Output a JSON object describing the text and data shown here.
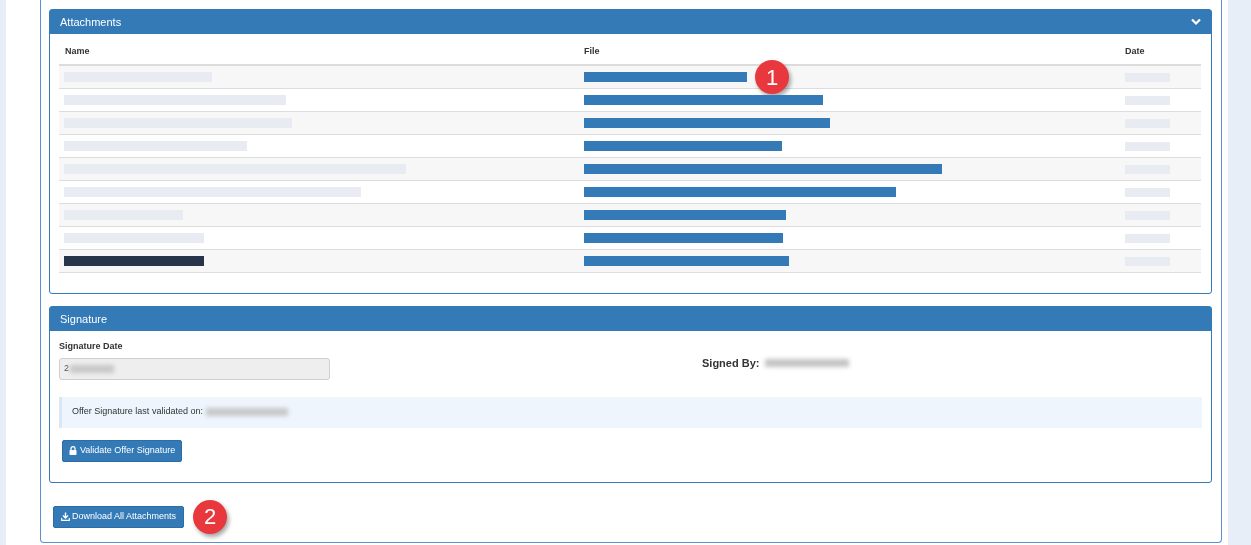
{
  "attachments": {
    "title": "Attachments",
    "expanded": true,
    "columns": [
      "Name",
      "File",
      "Date"
    ],
    "rows": [
      {
        "kind": "plain"
      },
      {
        "kind": "plain"
      },
      {
        "kind": "plain"
      },
      {
        "kind": "plain"
      },
      {
        "kind": "plain"
      },
      {
        "kind": "plain"
      },
      {
        "kind": "plain"
      },
      {
        "kind": "plain"
      },
      {
        "kind": "dark"
      }
    ]
  },
  "signature": {
    "title": "Signature",
    "date_label": "Signature Date",
    "date_value": "2",
    "signed_by_label": "Signed By:",
    "validated_text": "Offer Signature last validated on:",
    "validate_button": "Validate Offer Signature"
  },
  "download_button": "Download All Attachments",
  "callouts": [
    "1",
    "2"
  ]
}
